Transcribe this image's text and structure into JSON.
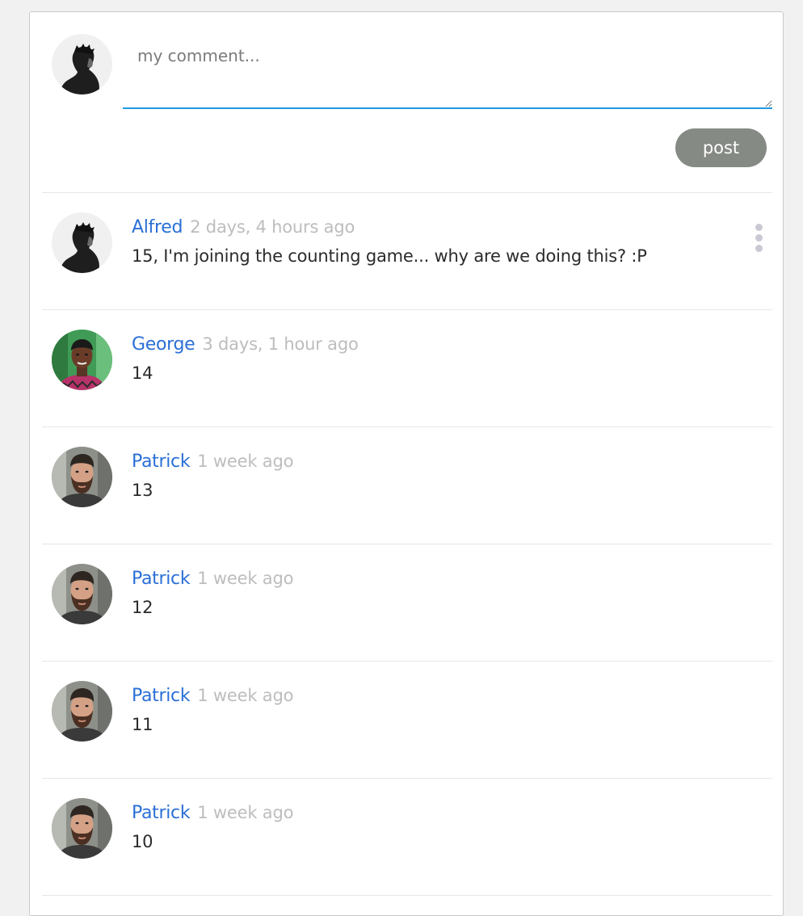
{
  "colors": {
    "accent_blue": "#1e9be3",
    "author_blue": "#2a6fd6",
    "post_button_bg": "#868a84",
    "timestamp_gray": "#bdbdbd"
  },
  "composer": {
    "placeholder": "my comment...",
    "value": "",
    "post_label": "post",
    "avatar_icon": "user-avatar-dark-silhouette"
  },
  "comments": [
    {
      "author": "Alfred",
      "time": "2 days, 4 hours ago",
      "text": "15, I'm joining the counting game... why are we doing this? :P",
      "avatar_icon": "user-avatar-dark-silhouette",
      "has_menu": true
    },
    {
      "author": "George",
      "time": "3 days, 1 hour ago",
      "text": "14",
      "avatar_icon": "user-avatar-george"
    },
    {
      "author": "Patrick",
      "time": "1 week ago",
      "text": "13",
      "avatar_icon": "user-avatar-patrick"
    },
    {
      "author": "Patrick",
      "time": "1 week ago",
      "text": "12",
      "avatar_icon": "user-avatar-patrick"
    },
    {
      "author": "Patrick",
      "time": "1 week ago",
      "text": "11",
      "avatar_icon": "user-avatar-patrick"
    },
    {
      "author": "Patrick",
      "time": "1 week ago",
      "text": "10",
      "avatar_icon": "user-avatar-patrick"
    }
  ]
}
